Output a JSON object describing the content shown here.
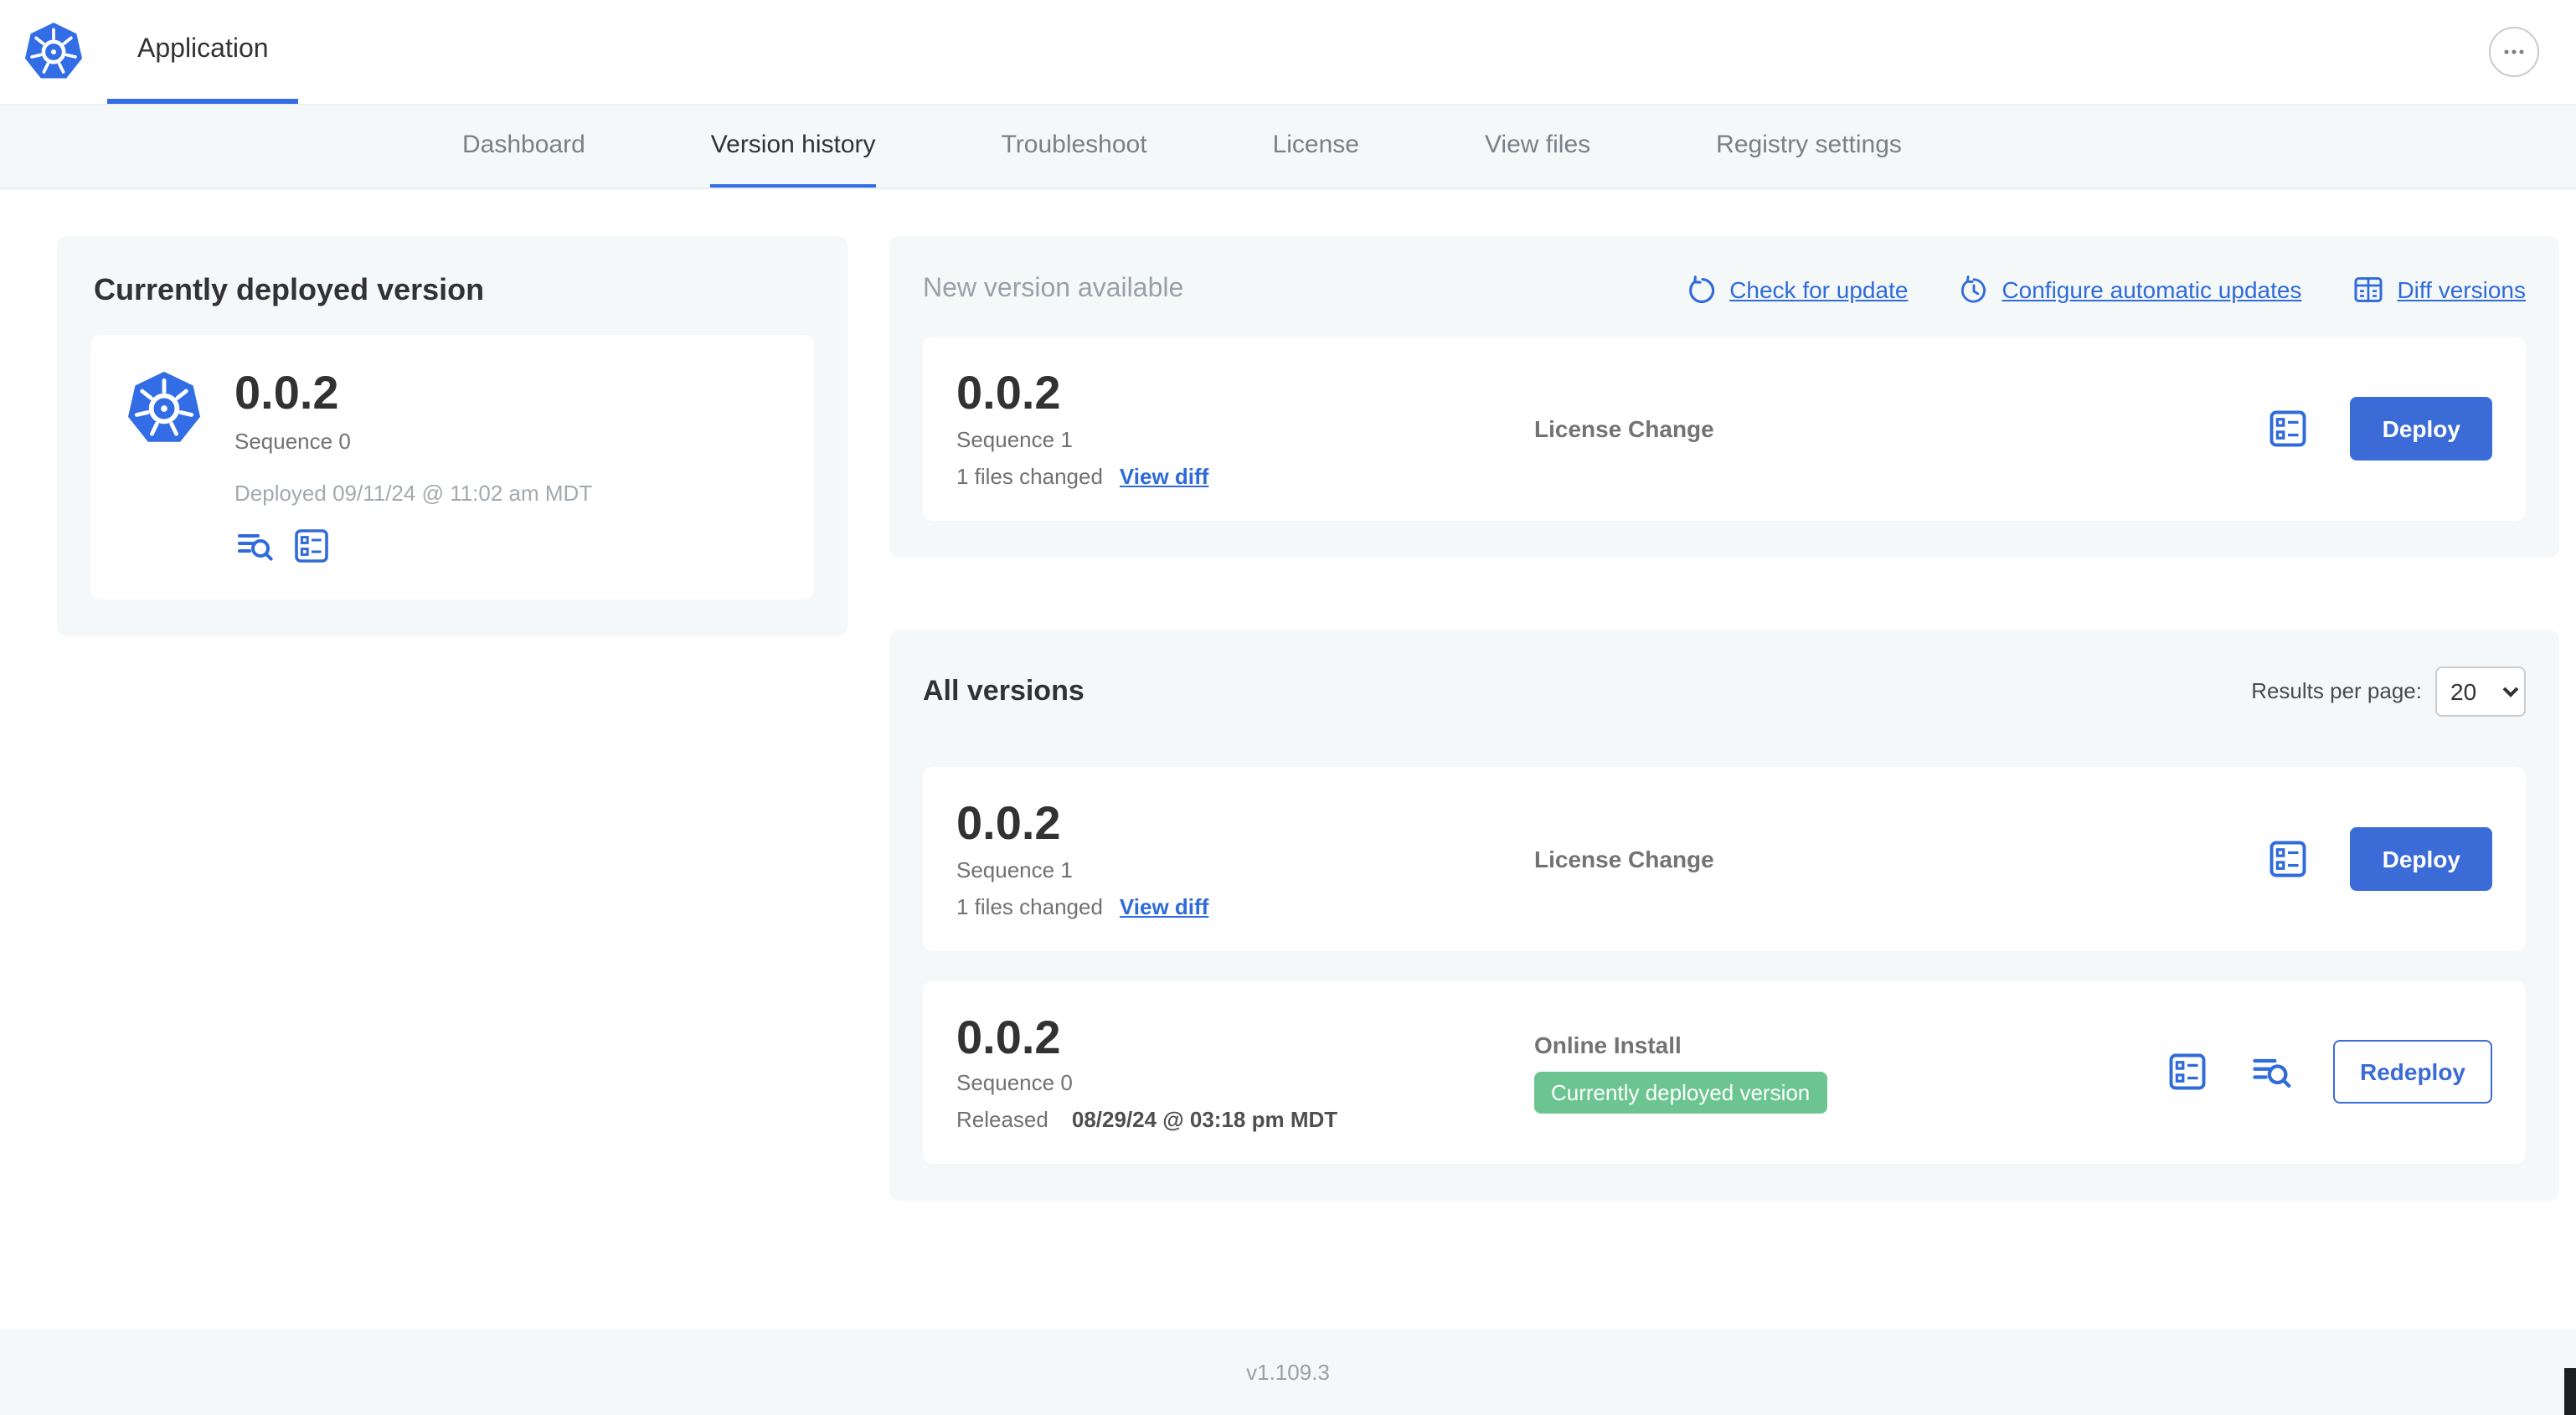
{
  "colors": {
    "accent": "#326de6",
    "button-blue": "#3b6bd6",
    "link-blue": "#2f6bd9",
    "badge-green": "#6cc591",
    "panel-gray": "#f5f8f9",
    "heading": "#323232",
    "muted": "#717171",
    "faint": "#a3a9ae"
  },
  "icons": {
    "app_logo": "kubernetes-helm",
    "more_menu": "ellipsis-circle",
    "check_for_update": "refresh-arrow",
    "configure_updates": "clock-refresh",
    "diff_versions": "diff-table",
    "config_values": "checklist",
    "logs": "lines-magnifier"
  },
  "header": {
    "app_tab": "Application"
  },
  "nav": {
    "tabs": [
      {
        "label": "Dashboard",
        "active": false
      },
      {
        "label": "Version history",
        "active": true
      },
      {
        "label": "Troubleshoot",
        "active": false
      },
      {
        "label": "License",
        "active": false
      },
      {
        "label": "View files",
        "active": false
      },
      {
        "label": "Registry settings",
        "active": false
      }
    ]
  },
  "deployed_card": {
    "title": "Currently deployed version",
    "version": "0.0.2",
    "sequence": "Sequence 0",
    "deployed_at": "Deployed 09/11/24 @ 11:02 am MDT"
  },
  "new_version_card": {
    "title": "New version available",
    "check_for_update": "Check for update",
    "configure_updates": "Configure automatic updates",
    "diff_versions": "Diff versions",
    "row": {
      "version": "0.0.2",
      "sequence": "Sequence 1",
      "files_changed": "1 files changed",
      "view_diff": "View diff",
      "change_type": "License Change",
      "deploy_label": "Deploy"
    }
  },
  "all_versions_card": {
    "title": "All versions",
    "results_per_page_label": "Results per page:",
    "results_per_page_value": "20",
    "rows": [
      {
        "version": "0.0.2",
        "sequence": "Sequence 1",
        "files_changed": "1 files changed",
        "view_diff": "View diff",
        "change_type": "License Change",
        "action_label": "Deploy"
      },
      {
        "version": "0.0.2",
        "sequence": "Sequence 0",
        "released_label": "Released",
        "released_at": "08/29/24 @ 03:18 pm MDT",
        "change_type": "Online Install",
        "status_badge": "Currently deployed version",
        "action_label": "Redeploy"
      }
    ]
  },
  "footer": {
    "app_version": "v1.109.3"
  }
}
